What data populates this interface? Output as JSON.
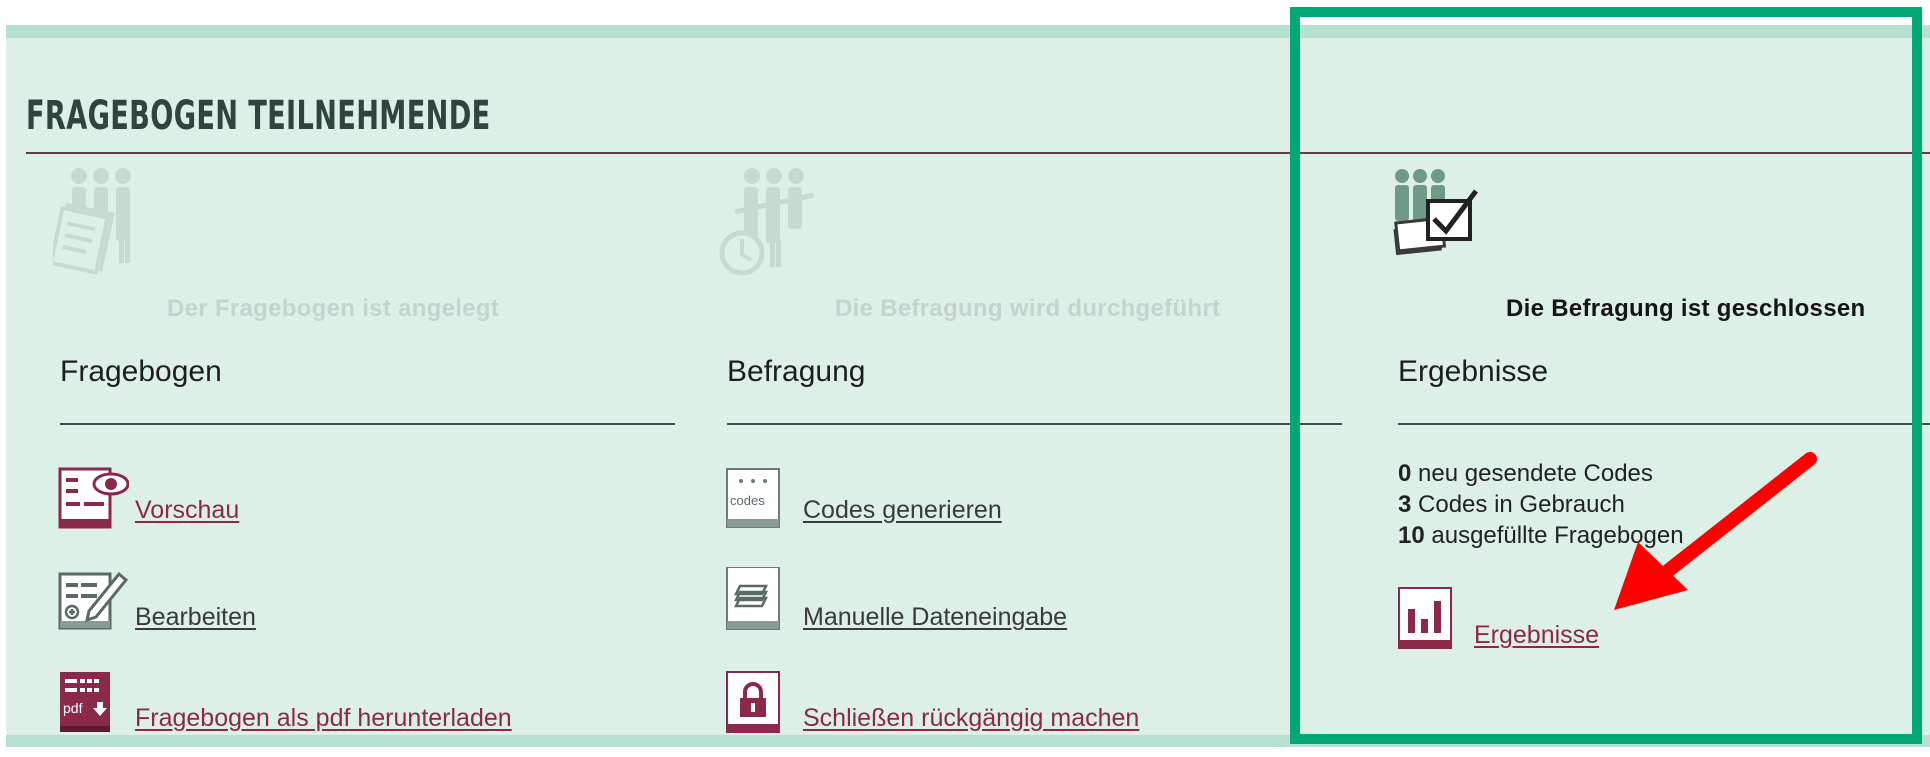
{
  "page": {
    "title": "FRAGEBOGEN TEILNEHMENDE"
  },
  "colors": {
    "panel": "#ddf0e8",
    "band": "#b6e0cf",
    "maroon": "#8a2a48",
    "highlight": "#00a878",
    "arrow": "#ff0000"
  },
  "columns": [
    {
      "status": "Der Fragebogen ist angelegt",
      "status_icon": "people-questionnaire-icon",
      "heading": "Fragebogen",
      "items": [
        {
          "label": "Vorschau",
          "icon": "preview-eye-icon"
        },
        {
          "label": "Bearbeiten",
          "icon": "edit-pencil-icon"
        },
        {
          "label": "Fragebogen als pdf herunterladen",
          "icon": "pdf-download-icon",
          "icon_text": "pdf"
        }
      ]
    },
    {
      "status": "Die Befragung wird durchgeführt",
      "status_icon": "people-clock-icon",
      "heading": "Befragung",
      "items": [
        {
          "label": "Codes generieren",
          "icon": "codes-icon",
          "icon_text": "codes"
        },
        {
          "label": "Manuelle Dateneingabe",
          "icon": "stack-documents-icon"
        },
        {
          "label": "Schließen rückgängig machen",
          "icon": "lock-icon"
        }
      ]
    },
    {
      "status": "Die Befragung ist geschlossen",
      "status_icon": "people-checkbox-icon",
      "heading": "Ergebnisse",
      "stats": [
        {
          "count": "0",
          "text": "neu gesendete Codes"
        },
        {
          "count": "3",
          "text": "Codes in Gebrauch"
        },
        {
          "count": "10",
          "text": "ausgefüllte Fragebogen"
        }
      ],
      "items": [
        {
          "label": "Ergebnisse",
          "icon": "bar-chart-icon"
        }
      ]
    }
  ]
}
